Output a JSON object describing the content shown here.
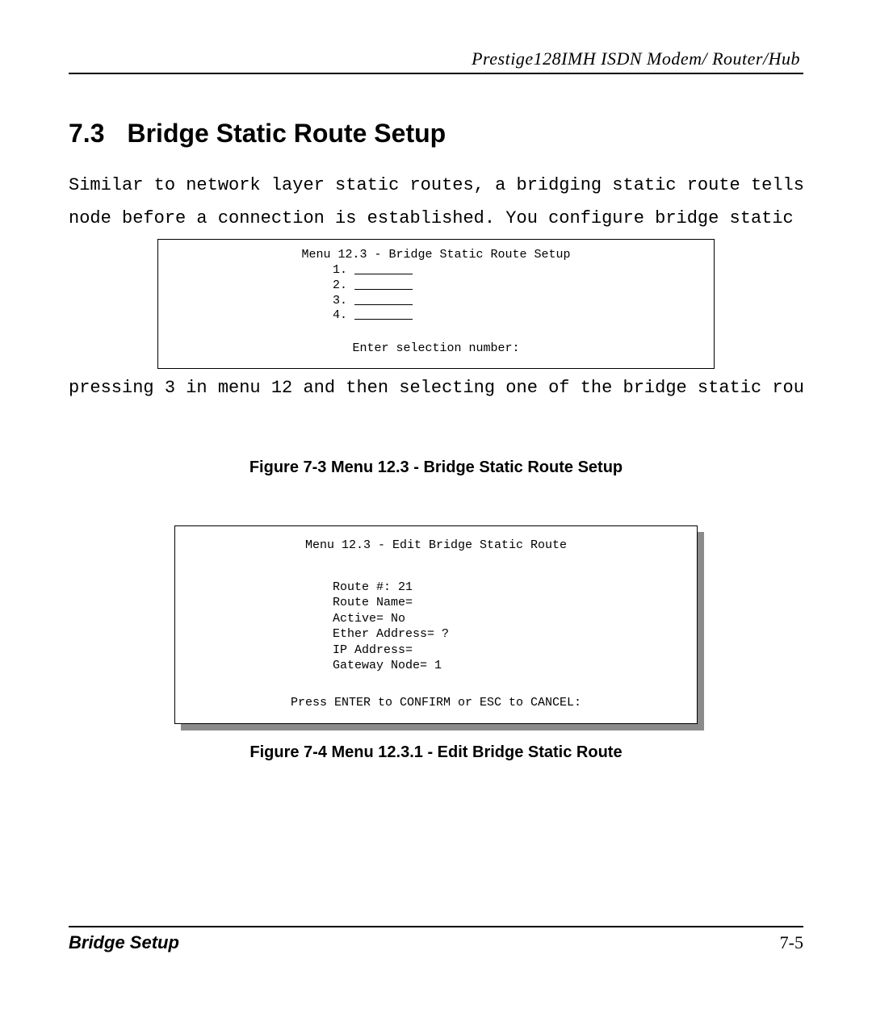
{
  "header": {
    "running_head": "Prestige128IMH  ISDN Modem/ Router/Hub"
  },
  "section": {
    "number": "7.3",
    "title": "Bridge Static Route Setup"
  },
  "body": {
    "p1": "Similar to network layer static routes, a bridging static route tells the Prestige about",
    "p2": "node before a connection is established. You configure bridge static routes in",
    "p3": "pressing 3 in menu 12 and then selecting one of the bridge static routes"
  },
  "menu1": {
    "title": "Menu 12.3 - Bridge Static Route Setup",
    "items": [
      {
        "n": "1.",
        "blank": "        "
      },
      {
        "n": "2.",
        "blank": "        "
      },
      {
        "n": "3.",
        "blank": "        "
      },
      {
        "n": "4.",
        "blank": "        "
      }
    ],
    "prompt": "Enter selection number:"
  },
  "caption1": "Figure 7-3 Menu 12.3 - Bridge Static Route Setup",
  "menu2": {
    "title": "Menu 12.3 - Edit Bridge Static Route",
    "fields": {
      "route_no": "Route #: 21",
      "route_name": "Route Name=",
      "active": "Active= No",
      "ether": "Ether Address= ?",
      "ip": "IP Address=",
      "gateway": "Gateway Node= 1"
    },
    "footer": "Press ENTER to CONFIRM or ESC to CANCEL:"
  },
  "caption2": "Figure 7-4 Menu 12.3.1 - Edit Bridge Static Route",
  "footer": {
    "left": "Bridge Setup",
    "right": "7-5"
  }
}
